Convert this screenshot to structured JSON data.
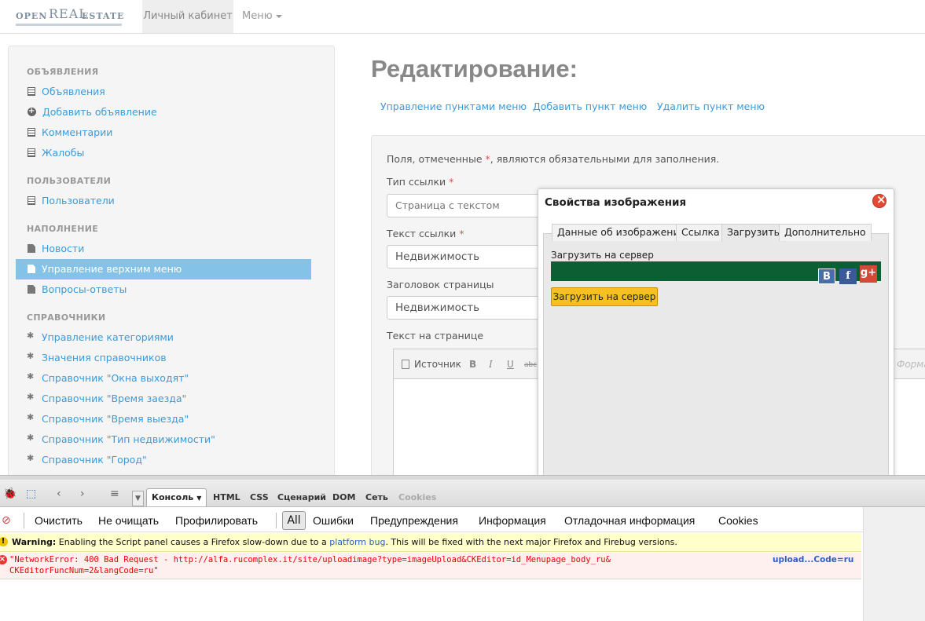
{
  "brand": {
    "open": "OPEN",
    "real": "REAL",
    "estate": "ESTATE"
  },
  "navbar": {
    "cabinet": "Личный кабинет",
    "menu": "Меню"
  },
  "sidebar": {
    "sections": [
      {
        "header": "ОБЪЯВЛЕНИЯ",
        "items": [
          {
            "label": "Объявления",
            "icon": "list-icon"
          },
          {
            "label": "Добавить объявление",
            "icon": "plus-circle-icon"
          },
          {
            "label": "Комментарии",
            "icon": "list-icon"
          },
          {
            "label": "Жалобы",
            "icon": "list-icon"
          }
        ]
      },
      {
        "header": "ПОЛЬЗОВАТЕЛИ",
        "items": [
          {
            "label": "Пользователи",
            "icon": "list-icon"
          }
        ]
      },
      {
        "header": "НАПОЛНЕНИЕ",
        "items": [
          {
            "label": "Новости",
            "icon": "file-icon"
          },
          {
            "label": "Управление верхним меню",
            "icon": "file-icon",
            "active": true
          },
          {
            "label": "Вопросы-ответы",
            "icon": "file-icon"
          }
        ]
      },
      {
        "header": "СПРАВОЧНИКИ",
        "items": [
          {
            "label": "Управление категориями",
            "icon": "asterisk-icon"
          },
          {
            "label": "Значения справочников",
            "icon": "asterisk-icon"
          },
          {
            "label": "Справочник \"Окна выходят\"",
            "icon": "asterisk-icon"
          },
          {
            "label": "Справочник \"Время заезда\"",
            "icon": "asterisk-icon"
          },
          {
            "label": "Справочник \"Время выезда\"",
            "icon": "asterisk-icon"
          },
          {
            "label": "Справочник \"Тип недвижимости\"",
            "icon": "asterisk-icon"
          },
          {
            "label": "Справочник \"Город\"",
            "icon": "asterisk-icon"
          }
        ]
      }
    ]
  },
  "main": {
    "title": "Редактирование:",
    "links": [
      "Управление пунктами меню",
      "Добавить пункт меню",
      "Удалить пункт меню"
    ],
    "form": {
      "required_note_pre": "Поля, отмеченные ",
      "required_star": "*",
      "required_note_post": ", являются обязательными для заполнения.",
      "link_type_label": "Тип ссылки ",
      "link_type_value": "Страница с текстом",
      "link_text_label": "Текст ссылки ",
      "link_text_value": "Недвижимость",
      "page_title_label": "Заголовок страницы",
      "page_title_value": "Недвижимость",
      "page_text_label": "Текст на странице"
    },
    "editor": {
      "source": "Источник",
      "bold": "B",
      "italic": "I",
      "underline": "U",
      "strike": "abc",
      "format": "Форма"
    }
  },
  "dialog": {
    "title": "Свойства изображения",
    "tabs": [
      "Данные об изображении",
      "Ссылка",
      "Загрузить",
      "Дополнительно"
    ],
    "active_tab": "Загрузить",
    "upload_label": "Загрузить на сервер",
    "upload_button": "Загрузить на сервер",
    "social": [
      "B",
      "f",
      "g+"
    ]
  },
  "firebug": {
    "tabs": [
      "Консоль",
      "HTML",
      "CSS",
      "Сценарий",
      "DOM",
      "Сеть",
      "Cookies"
    ],
    "commands": [
      "Очистить",
      "Не очищать",
      "Профилировать"
    ],
    "filters": [
      "All",
      "Ошибки",
      "Предупреждения",
      "Информация",
      "Отладочная информация",
      "Cookies"
    ],
    "warning": {
      "label": "Warning:",
      "text_pre": " Enabling the Script panel causes a Firefox slow-down due to a ",
      "link": "platform bug",
      "text_post": ". This will be fixed with the next major Firefox and Firebug versions."
    },
    "error": {
      "line1": "\"NetworkError: 400 Bad Request - http://alfa.rucomplex.it/site/uploadimage?type=imageUpload&CKEditor=id_Menupage_body_ru&",
      "line2": "CKEditorFuncNum=2&langCode=ru\"",
      "source": "upload...Code=ru"
    }
  }
}
